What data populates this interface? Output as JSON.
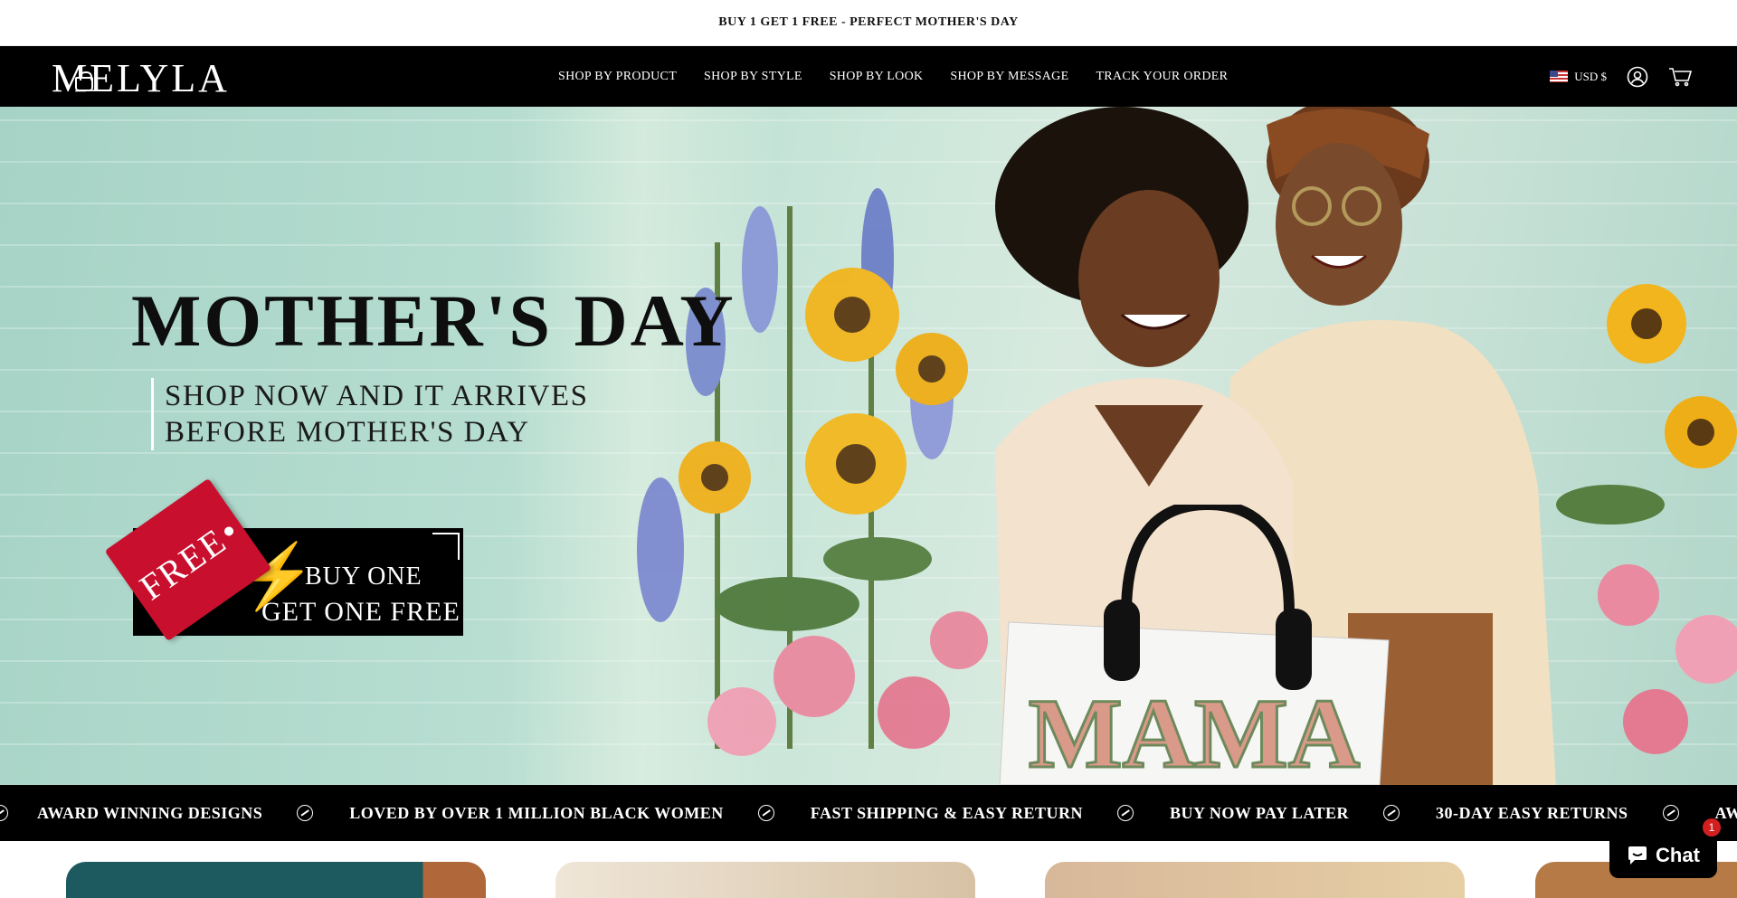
{
  "announcement": {
    "text": "BUY 1 GET 1 FREE - PERFECT MOTHER'S DAY"
  },
  "header": {
    "logo": "MELYLA",
    "nav": [
      {
        "label": "SHOP BY PRODUCT"
      },
      {
        "label": "SHOP BY STYLE"
      },
      {
        "label": "SHOP BY LOOK"
      },
      {
        "label": "SHOP BY MESSAGE"
      },
      {
        "label": "TRACK YOUR ORDER"
      }
    ],
    "currency": "USD $",
    "icons": {
      "account": "account-icon",
      "cart": "cart-icon",
      "flag": "us-flag-icon"
    }
  },
  "hero": {
    "title": "MOTHER'S DAY",
    "subtitle_line1": "SHOP NOW AND IT ARRIVES",
    "subtitle_line2": "BEFORE MOTHER'S DAY",
    "tag": "FREE",
    "bogo_line1": "BUY ONE",
    "bogo_line2": "GET ONE FREE",
    "bag_text": "MAMA"
  },
  "marquee": [
    "AWARD WINNING DESIGNS",
    "LOVED BY OVER 1 MILLION BLACK WOMEN",
    "FAST SHIPPING & EASY RETURN",
    "BUY NOW PAY LATER",
    "30-DAY EASY RETURNS",
    "AWARD WINNING DESIGNS"
  ],
  "chat": {
    "label": "Chat",
    "badge": "1"
  },
  "colors": {
    "accent_red": "#c8102e",
    "header_bg": "#000000",
    "hero_bg": "#b6ddd0"
  }
}
